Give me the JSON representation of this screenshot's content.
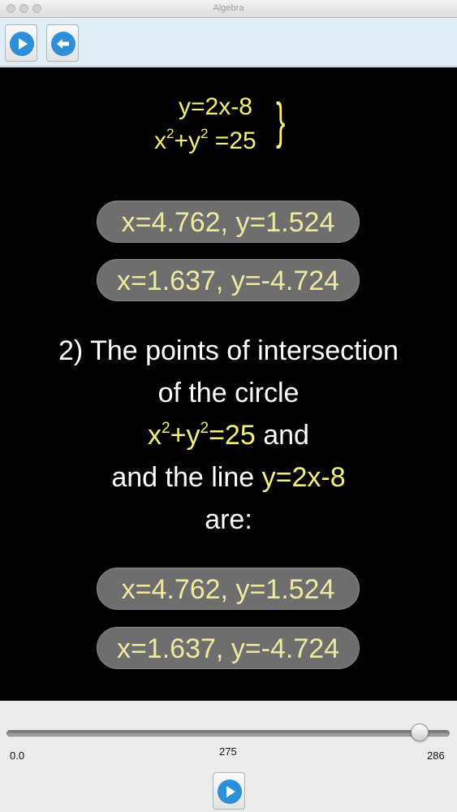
{
  "window": {
    "title": "Algebra"
  },
  "toolbar": {
    "play_icon": "play-icon",
    "back_icon": "back-arrow-icon"
  },
  "equations": {
    "line1": "y=2x-8",
    "line2_base": "x",
    "line2_sup1": "2",
    "line2_mid": "+y",
    "line2_sup2": "2",
    "line2_end": " =25",
    "brace": "}"
  },
  "results_top": [
    "x=4.762, y=1.524",
    "x=1.637, y=-4.724"
  ],
  "statement": {
    "line1": "2) The points of intersection",
    "line2": "of the circle",
    "line3_x": "x",
    "line3_sup1": "2",
    "line3_mid": "+y",
    "line3_sup2": "2",
    "line3_end": "=25",
    "line3_and": " and",
    "line4_text": "and the line ",
    "line4_eq": "y=2x-8",
    "line5": "are:"
  },
  "results_bottom": [
    "x=4.762, y=1.524",
    "x=1.637, y=-4.724"
  ],
  "slider": {
    "min_label": "0.0",
    "current_label": "275",
    "max_label": "286",
    "min": 0.0,
    "max": 286,
    "value": 275
  },
  "colors": {
    "highlight": "#f5f07a",
    "pill_text": "#efe9a0",
    "pill_bg": "#6e6e6e",
    "stage_bg": "#000000",
    "accent": "#2e8fd9"
  }
}
